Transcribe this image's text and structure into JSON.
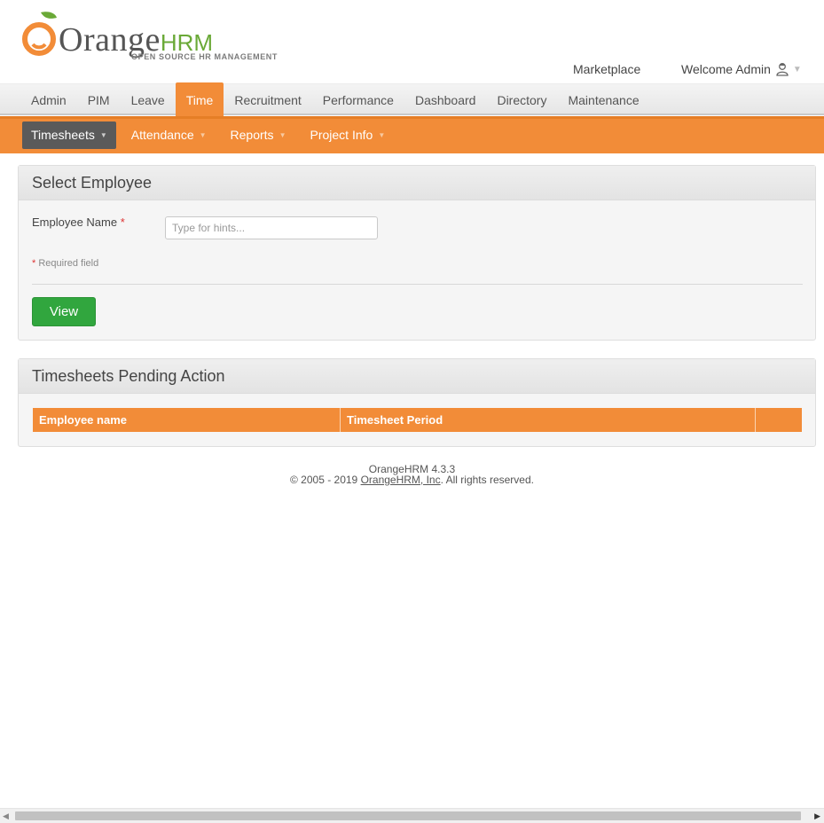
{
  "brand": {
    "logo_main": "Orange",
    "logo_accent": "HRM",
    "tagline": "OPEN SOURCE HR MANAGEMENT"
  },
  "top_links": {
    "marketplace": "Marketplace",
    "welcome": "Welcome Admin"
  },
  "main_menu": [
    {
      "label": "Admin"
    },
    {
      "label": "PIM"
    },
    {
      "label": "Leave"
    },
    {
      "label": "Time",
      "active": true
    },
    {
      "label": "Recruitment"
    },
    {
      "label": "Performance"
    },
    {
      "label": "Dashboard"
    },
    {
      "label": "Directory"
    },
    {
      "label": "Maintenance"
    }
  ],
  "sub_menu": [
    {
      "label": "Timesheets",
      "active": true
    },
    {
      "label": "Attendance"
    },
    {
      "label": "Reports"
    },
    {
      "label": "Project Info"
    }
  ],
  "select_employee": {
    "title": "Select Employee",
    "field_label": "Employee Name",
    "required_star": "*",
    "input_placeholder": "Type for hints...",
    "input_value": "",
    "required_note_star": "*",
    "required_note": "Required field",
    "view_button": "View"
  },
  "pending": {
    "title": "Timesheets Pending Action",
    "columns": [
      "Employee name",
      "Timesheet Period",
      ""
    ]
  },
  "footer": {
    "version": "OrangeHRM 4.3.3",
    "copyright_prefix": "© 2005 - 2019 ",
    "company_link": "OrangeHRM, Inc",
    "copyright_suffix": ". All rights reserved."
  },
  "colors": {
    "accent_orange": "#f28c38",
    "active_submenu": "#5a5a5a",
    "button_green": "#31a63e",
    "logo_green": "#6aa937"
  },
  "icons": {
    "user": "user-icon",
    "caret": "caret-down-icon"
  }
}
